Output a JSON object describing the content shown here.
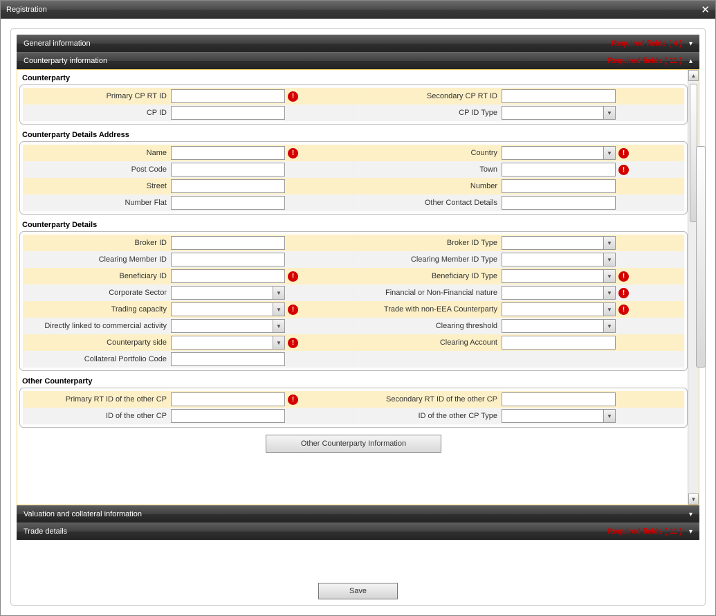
{
  "window_title": "Registration",
  "sections": {
    "general": {
      "title": "General information",
      "required_text": "Required fields ( 4 )",
      "expanded": false
    },
    "counterparty": {
      "title": "Counterparty information",
      "required_text": "Required fields ( 11 )",
      "expanded": true
    },
    "valuation": {
      "title": "Valuation and collateral information",
      "required_text": "",
      "expanded": false
    },
    "trade": {
      "title": "Trade details",
      "required_text": "Required fields ( 11 )",
      "expanded": false
    }
  },
  "groups": {
    "cp": {
      "title": "Counterparty",
      "rows": [
        {
          "stripe": 0,
          "left": {
            "label": "Primary CP RT ID",
            "type": "text",
            "value": "",
            "required": true
          },
          "right": {
            "label": "Secondary CP RT ID",
            "type": "text",
            "value": "",
            "required": false
          }
        },
        {
          "stripe": 1,
          "left": {
            "label": "CP ID",
            "type": "text",
            "value": "",
            "required": false
          },
          "right": {
            "label": "CP ID Type",
            "type": "select",
            "value": "",
            "required": false
          }
        }
      ]
    },
    "addr": {
      "title": "Counterparty Details Address",
      "rows": [
        {
          "stripe": 0,
          "left": {
            "label": "Name",
            "type": "text",
            "value": "",
            "required": true
          },
          "right": {
            "label": "Country",
            "type": "select",
            "value": "",
            "required": true
          }
        },
        {
          "stripe": 1,
          "left": {
            "label": "Post Code",
            "type": "text",
            "value": "",
            "required": false
          },
          "right": {
            "label": "Town",
            "type": "text",
            "value": "",
            "required": true
          }
        },
        {
          "stripe": 0,
          "left": {
            "label": "Street",
            "type": "text",
            "value": "",
            "required": false
          },
          "right": {
            "label": "Number",
            "type": "text",
            "value": "",
            "required": false
          }
        },
        {
          "stripe": 1,
          "left": {
            "label": "Number Flat",
            "type": "text",
            "value": "",
            "required": false
          },
          "right": {
            "label": "Other Contact Details",
            "type": "text",
            "value": "",
            "required": false
          }
        }
      ]
    },
    "details": {
      "title": "Counterparty Details",
      "rows": [
        {
          "stripe": 0,
          "left": {
            "label": "Broker ID",
            "type": "text",
            "value": "",
            "required": false
          },
          "right": {
            "label": "Broker ID Type",
            "type": "select",
            "value": "",
            "required": false
          }
        },
        {
          "stripe": 1,
          "left": {
            "label": "Clearing Member ID",
            "type": "text",
            "value": "",
            "required": false
          },
          "right": {
            "label": "Clearing Member ID Type",
            "type": "select",
            "value": "",
            "required": false
          }
        },
        {
          "stripe": 0,
          "left": {
            "label": "Beneficiary ID",
            "type": "text",
            "value": "",
            "required": true
          },
          "right": {
            "label": "Beneficiary ID Type",
            "type": "select",
            "value": "",
            "required": true
          }
        },
        {
          "stripe": 1,
          "left": {
            "label": "Corporate Sector",
            "type": "select",
            "value": "",
            "required": false
          },
          "right": {
            "label": "Financial or Non-Financial nature",
            "type": "select",
            "value": "",
            "required": true
          }
        },
        {
          "stripe": 0,
          "left": {
            "label": "Trading capacity",
            "type": "select",
            "value": "",
            "required": true
          },
          "right": {
            "label": "Trade with non-EEA Counterparty",
            "type": "select",
            "value": "",
            "required": true
          }
        },
        {
          "stripe": 1,
          "left": {
            "label": "Directly linked to commercial activity",
            "type": "select",
            "value": "",
            "required": false
          },
          "right": {
            "label": "Clearing threshold",
            "type": "select",
            "value": "",
            "required": false
          }
        },
        {
          "stripe": 0,
          "left": {
            "label": "Counterparty side",
            "type": "select",
            "value": "",
            "required": true
          },
          "right": {
            "label": "Clearing Account",
            "type": "text",
            "value": "",
            "required": false
          }
        },
        {
          "stripe": 1,
          "left": {
            "label": "Collateral Portfolio Code",
            "type": "text",
            "value": "",
            "required": false
          },
          "right": null
        }
      ]
    },
    "other": {
      "title": "Other Counterparty",
      "rows": [
        {
          "stripe": 0,
          "left": {
            "label": "Primary RT ID of the other CP",
            "type": "text",
            "value": "",
            "required": true
          },
          "right": {
            "label": "Secondary RT ID of the other CP",
            "type": "text",
            "value": "",
            "required": false
          }
        },
        {
          "stripe": 1,
          "left": {
            "label": "ID of the other CP",
            "type": "text",
            "value": "",
            "required": false
          },
          "right": {
            "label": "ID of the other CP Type",
            "type": "select",
            "value": "",
            "required": false
          }
        }
      ]
    }
  },
  "other_cp_button": "Other Counterparty Information",
  "save_button": "Save"
}
